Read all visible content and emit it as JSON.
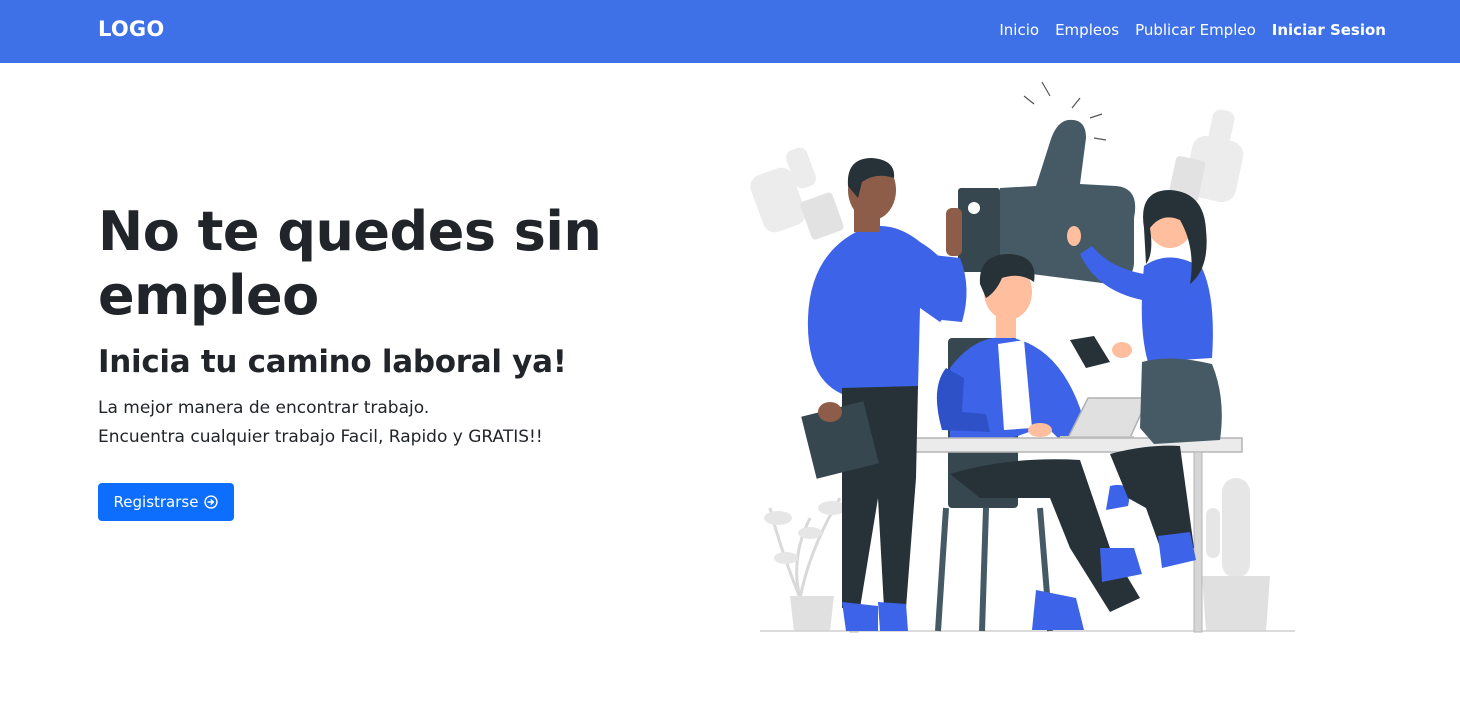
{
  "navbar": {
    "logo": "LOGO",
    "links": [
      "Inicio",
      "Empleos",
      "Publicar Empleo",
      "Iniciar Sesion"
    ]
  },
  "hero": {
    "title": "No te quedes sin empleo",
    "subtitle": "Inicia tu camino laboral ya!",
    "line1": "La mejor manera de encontrar trabajo.",
    "line2": "Encuentra cualquier trabajo Facil, Rapido y GRATIS!!",
    "button_label": "Registrarse",
    "button_icon": "arrow-right-circle-icon"
  },
  "colors": {
    "navbar": "#3e70e8",
    "button": "#0d6efd",
    "text": "#212529",
    "illustration_blue": "#3d63e8",
    "illustration_dark": "#263238"
  }
}
